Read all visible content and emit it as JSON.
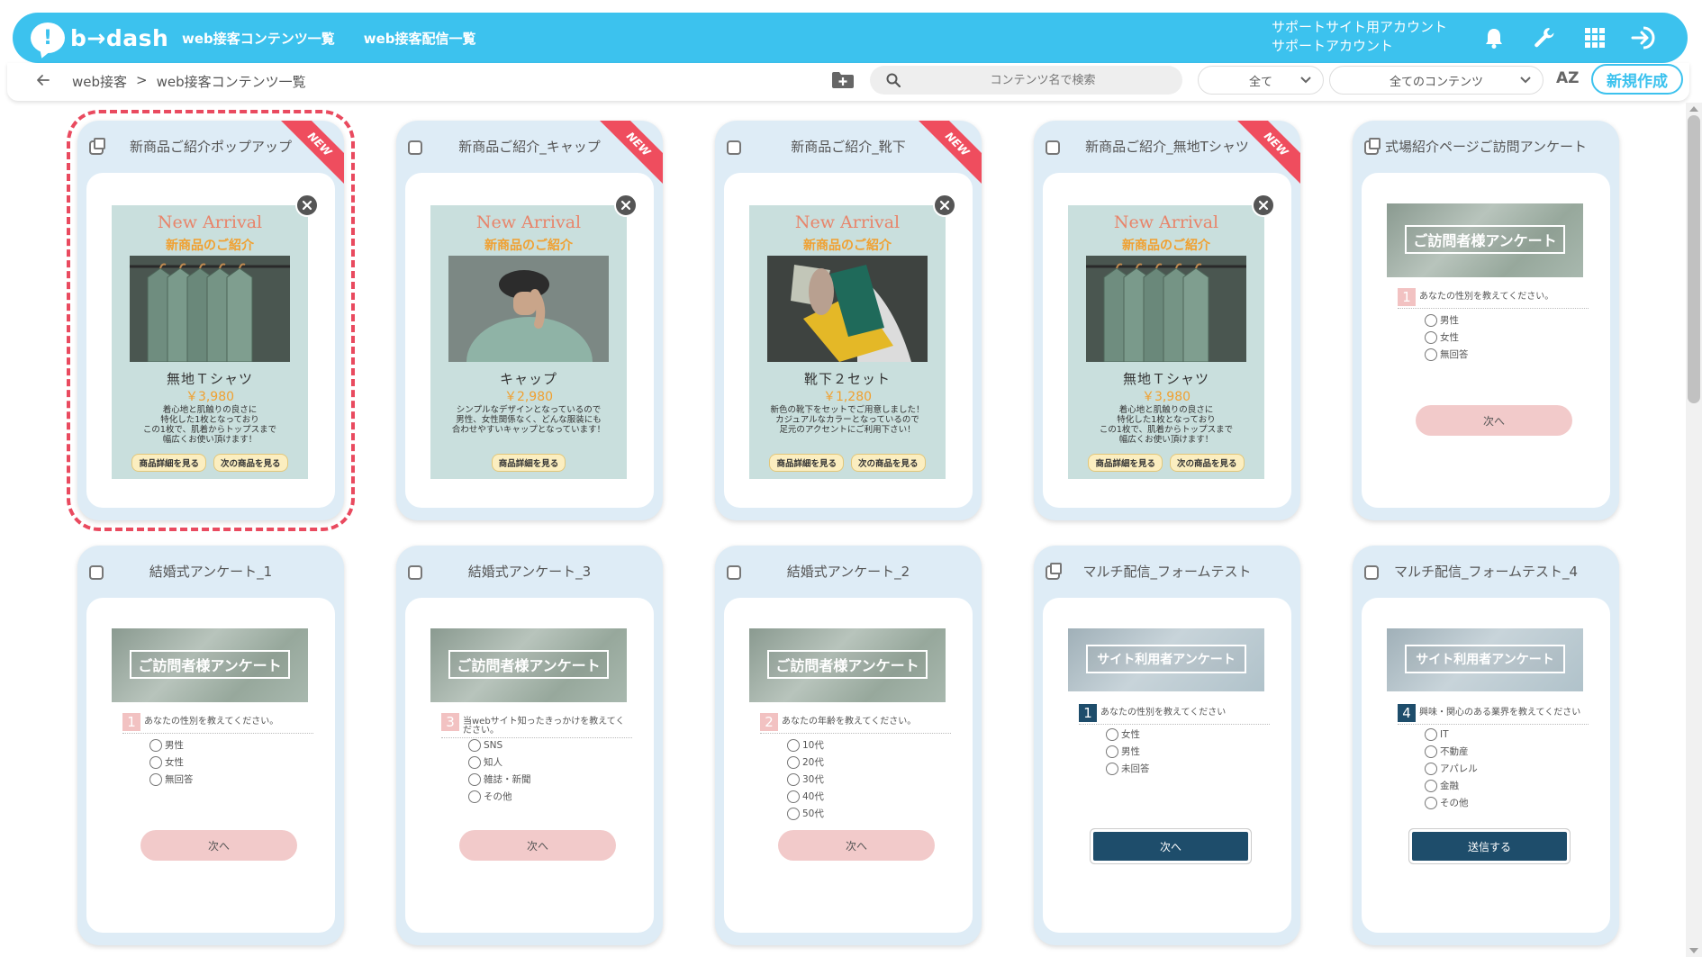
{
  "header": {
    "logo_text": "b→dash",
    "logo_mark": "!",
    "nav": [
      "web接客コンテンツ一覧",
      "web接客配信一覧"
    ],
    "account_line1": "サポートサイト用アカウント",
    "account_line2": "サポートアカウント",
    "icons": [
      "bell-icon",
      "wrench-icon",
      "grid-icon",
      "logout-icon"
    ]
  },
  "toolbar": {
    "breadcrumb_root": "web接客",
    "breadcrumb_sep": ">",
    "breadcrumb_current": "web接客コンテンツ一覧",
    "search_placeholder": "コンテンツ名で検索",
    "filter1": "全て",
    "filter2": "全てのコンテンツ",
    "sort_label": "AZ",
    "new_button": "新規作成"
  },
  "colors": {
    "brand": "#3cc2ee",
    "ribbon": "#ef4d5e",
    "accent_orange": "#f0a030",
    "survey_dark": "#1e4d6b",
    "survey_pink": "#f2c2c2"
  },
  "ribbon_text": "NEW",
  "cards": [
    {
      "title": "新商品ご紹介ポップアップ",
      "new": true,
      "kind": "popup",
      "en": "New Arrival",
      "jp": "新商品のご紹介",
      "name": "無地Ｔシャツ",
      "price": "￥3,980",
      "desc": "着心地と肌触りの良さに\n特化した1枚となっており\nこの1枚で、肌着からトップスまで\n幅広くお使い頂けます！",
      "btn1": "商品詳細を見る",
      "btn2": "次の商品を見る"
    },
    {
      "title": "新商品ご紹介_キャップ",
      "new": true,
      "kind": "popup",
      "en": "New Arrival",
      "jp": "新商品のご紹介",
      "name": "キャップ",
      "price": "￥2,980",
      "desc": "シンプルなデザインとなっているので\n男性、女性関係なく、どんな服装にも\n合わせやすいキャップとなっています！",
      "btn1": "商品詳細を見る",
      "btn2": ""
    },
    {
      "title": "新商品ご紹介_靴下",
      "new": true,
      "kind": "popup",
      "en": "New Arrival",
      "jp": "新商品のご紹介",
      "name": "靴下２セット",
      "price": "￥1,280",
      "desc": "新色の靴下をセットでご用意しました！\nカジュアルなカラーとなっているので\n足元のアクセントにご利用下さい！",
      "btn1": "商品詳細を見る",
      "btn2": "次の商品を見る"
    },
    {
      "title": "新商品ご紹介_無地Tシャツ",
      "new": true,
      "kind": "popup",
      "en": "New Arrival",
      "jp": "新商品のご紹介",
      "name": "無地Ｔシャツ",
      "price": "￥3,980",
      "desc": "着心地と肌触りの良さに\n特化した1枚となっており\nこの1枚で、肌着からトップスまで\n幅広くお使い頂けます！",
      "btn1": "商品詳細を見る",
      "btn2": "次の商品を見る"
    },
    {
      "title": "式場紹介ページご訪問アンケート",
      "new": false,
      "kind": "survey",
      "banner": "ご訪問者様アンケート",
      "num": "1",
      "question": "あなたの性別を教えてください。",
      "options": [
        "男性",
        "女性",
        "無回答"
      ],
      "next": "次へ"
    },
    {
      "title": "結婚式アンケート_1",
      "new": false,
      "kind": "survey",
      "banner": "ご訪問者様アンケート",
      "num": "1",
      "question": "あなたの性別を教えてください。",
      "options": [
        "男性",
        "女性",
        "無回答"
      ],
      "next": "次へ"
    },
    {
      "title": "結婚式アンケート_3",
      "new": false,
      "kind": "survey",
      "banner": "ご訪問者様アンケート",
      "num": "3",
      "question": "当webサイト知ったきっかけを教えてください。",
      "options": [
        "SNS",
        "知人",
        "雑誌・新聞",
        "その他"
      ],
      "next": "次へ"
    },
    {
      "title": "結婚式アンケート_2",
      "new": false,
      "kind": "survey",
      "banner": "ご訪問者様アンケート",
      "num": "2",
      "question": "あなたの年齢を教えてください。",
      "options": [
        "10代",
        "20代",
        "30代",
        "40代",
        "50代"
      ],
      "next": "次へ"
    },
    {
      "title": "マルチ配信_フォームテスト",
      "new": false,
      "kind": "survey2",
      "banner": "サイト利用者アンケート",
      "num": "1",
      "question": "あなたの性別を教えてください",
      "options": [
        "女性",
        "男性",
        "未回答"
      ],
      "next": "次へ"
    },
    {
      "title": "マルチ配信_フォームテスト_4",
      "new": false,
      "kind": "survey2",
      "banner": "サイト利用者アンケート",
      "num": "4",
      "question": "興味・関心のある業界を教えてください",
      "options": [
        "IT",
        "不動産",
        "アパレル",
        "金融",
        "その他"
      ],
      "next": "送信する"
    }
  ]
}
